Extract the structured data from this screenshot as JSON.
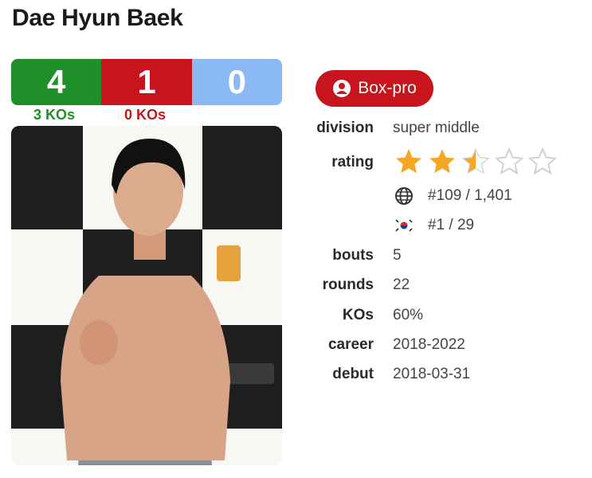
{
  "fighter": {
    "name": "Dae Hyun Baek"
  },
  "record": {
    "wins": "4",
    "losses": "1",
    "draws": "0",
    "win_kos": "3 KOs",
    "loss_kos": "0 KOs"
  },
  "colors": {
    "win": "#1f8f2a",
    "loss": "#c8151d",
    "draw": "#8ab9f5",
    "star": "#f5a623"
  },
  "badge": {
    "label": "Box-pro",
    "icon": "user-circle-icon"
  },
  "details": {
    "division_label": "division",
    "division": "super middle",
    "rating_label": "rating",
    "rating_stars": 2.5,
    "rating_max": 5,
    "world_rank": "#109 / 1,401",
    "world_rank_icon": "globe-icon",
    "country_rank": "#1 / 29",
    "country_rank_icon": "south-korea-flag-icon",
    "bouts_label": "bouts",
    "bouts": "5",
    "rounds_label": "rounds",
    "rounds": "22",
    "kos_label": "KOs",
    "kos": "60%",
    "career_label": "career",
    "career": "2018-2022",
    "debut_label": "debut",
    "debut": "2018-03-31"
  }
}
